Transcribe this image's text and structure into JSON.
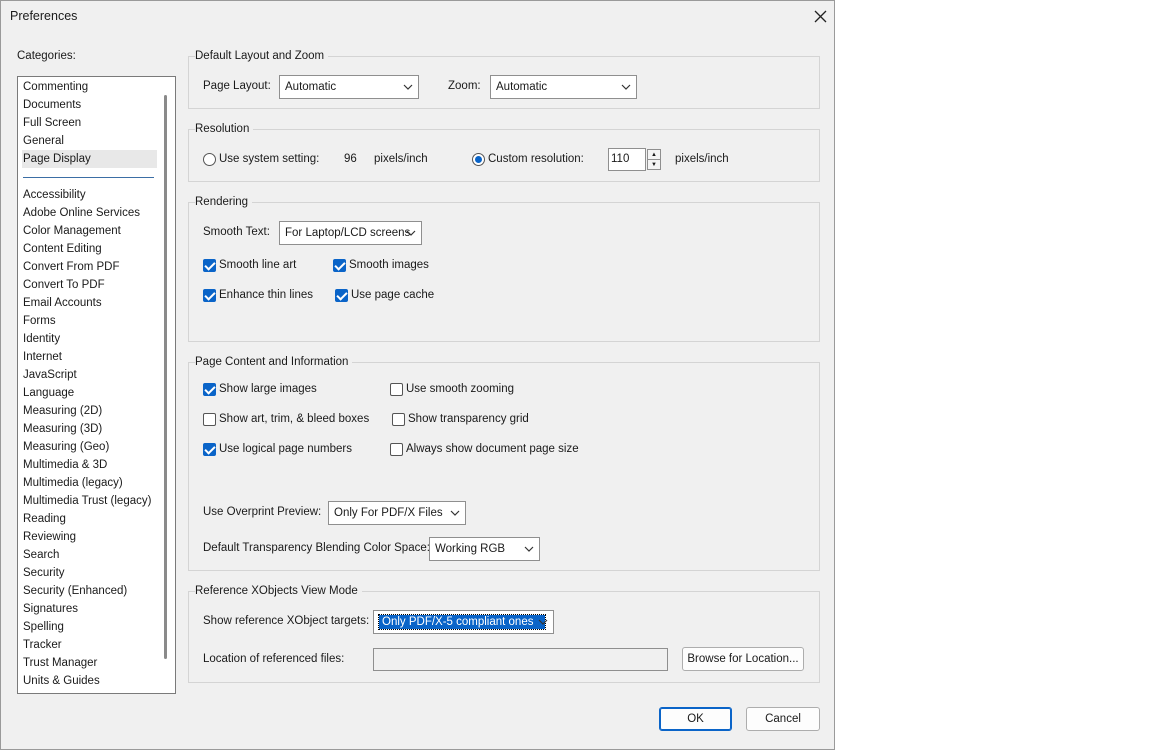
{
  "window": {
    "title": "Preferences"
  },
  "categories": {
    "label": "Categories:",
    "top_items": [
      "Commenting",
      "Documents",
      "Full Screen",
      "General",
      "Page Display"
    ],
    "selected": "Page Display",
    "items": [
      "Accessibility",
      "Adobe Online Services",
      "Color Management",
      "Content Editing",
      "Convert From PDF",
      "Convert To PDF",
      "Email Accounts",
      "Forms",
      "Identity",
      "Internet",
      "JavaScript",
      "Language",
      "Measuring (2D)",
      "Measuring (3D)",
      "Measuring (Geo)",
      "Multimedia & 3D",
      "Multimedia (legacy)",
      "Multimedia Trust (legacy)",
      "Reading",
      "Reviewing",
      "Search",
      "Security",
      "Security (Enhanced)",
      "Signatures",
      "Spelling",
      "Tracker",
      "Trust Manager",
      "Units & Guides"
    ]
  },
  "layout_zoom": {
    "title": "Default Layout and Zoom",
    "page_layout_label": "Page Layout:",
    "page_layout_value": "Automatic",
    "zoom_label": "Zoom:",
    "zoom_value": "Automatic"
  },
  "resolution": {
    "title": "Resolution",
    "system_label": "Use system setting:",
    "system_value": "96",
    "system_unit": "pixels/inch",
    "custom_label": "Custom resolution:",
    "custom_value": "110",
    "custom_unit": "pixels/inch",
    "selected": "custom"
  },
  "rendering": {
    "title": "Rendering",
    "smooth_text_label": "Smooth Text:",
    "smooth_text_value": "For Laptop/LCD screens",
    "smooth_line_art": {
      "label": "Smooth line art",
      "checked": true
    },
    "smooth_images": {
      "label": "Smooth images",
      "checked": true
    },
    "enhance_thin_lines": {
      "label": "Enhance thin lines",
      "checked": true
    },
    "use_page_cache": {
      "label": "Use page cache",
      "checked": true
    }
  },
  "page_content": {
    "title": "Page Content and Information",
    "show_large_images": {
      "label": "Show large images",
      "checked": true
    },
    "use_smooth_zooming": {
      "label": "Use smooth zooming",
      "checked": false
    },
    "show_art_trim": {
      "label": "Show art, trim, & bleed boxes",
      "checked": false
    },
    "show_transparency_grid": {
      "label": "Show transparency grid",
      "checked": false
    },
    "use_logical_page_numbers": {
      "label": "Use logical page numbers",
      "checked": true
    },
    "always_show_doc_size": {
      "label": "Always show document page size",
      "checked": false
    },
    "overprint_label": "Use Overprint Preview:",
    "overprint_value": "Only For PDF/X Files",
    "blend_label": "Default Transparency Blending Color Space:",
    "blend_value": "Working RGB"
  },
  "xobjects": {
    "title": "Reference XObjects View Mode",
    "targets_label": "Show reference XObject targets:",
    "targets_value": "Only PDF/X-5 compliant ones",
    "location_label": "Location of referenced files:",
    "location_value": "",
    "browse_label": "Browse for Location..."
  },
  "buttons": {
    "ok": "OK",
    "cancel": "Cancel"
  }
}
